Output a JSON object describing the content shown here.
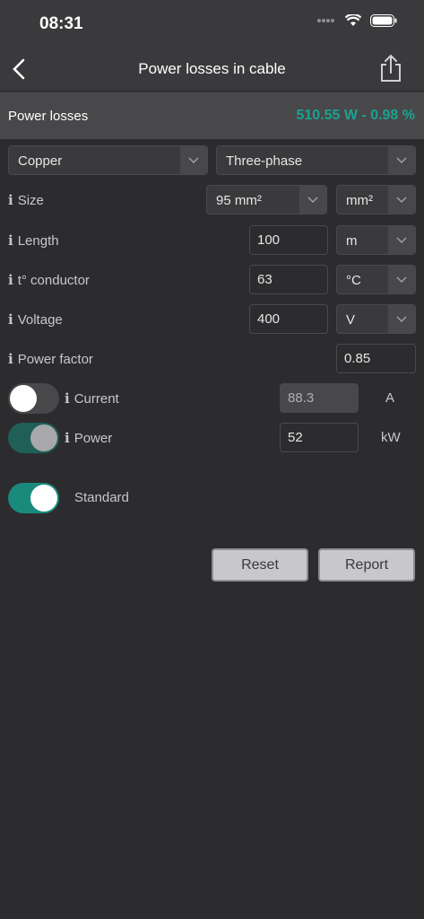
{
  "status": {
    "time": "08:31"
  },
  "nav": {
    "title": "Power losses in cable",
    "back_icon": "chevron-left-icon",
    "share_icon": "share-icon"
  },
  "summary": {
    "label": "Power losses",
    "value": "510.55 W - 0.98 %",
    "value_color": "#1aa391"
  },
  "material": {
    "selected": "Copper"
  },
  "phase": {
    "selected": "Three-phase"
  },
  "size": {
    "label": "Size",
    "value": "95 mm²",
    "unit": "mm²"
  },
  "length": {
    "label": "Length",
    "value": "100",
    "unit": "m"
  },
  "temperature": {
    "label": "t° conductor",
    "value": "63",
    "unit": "°C"
  },
  "voltage": {
    "label": "Voltage",
    "value": "400",
    "unit": "V"
  },
  "power_factor": {
    "label": "Power factor",
    "value": "0.85"
  },
  "current": {
    "label": "Current",
    "value": "88.3",
    "unit": "A",
    "toggle_on": false
  },
  "power": {
    "label": "Power",
    "value": "52",
    "unit": "kW",
    "toggle_on": true
  },
  "standard": {
    "label": "Standard",
    "toggle_on": true
  },
  "buttons": {
    "reset": "Reset",
    "report": "Report"
  },
  "colors": {
    "accent": "#1aa391",
    "toggle_on": "#1a8a7c"
  }
}
